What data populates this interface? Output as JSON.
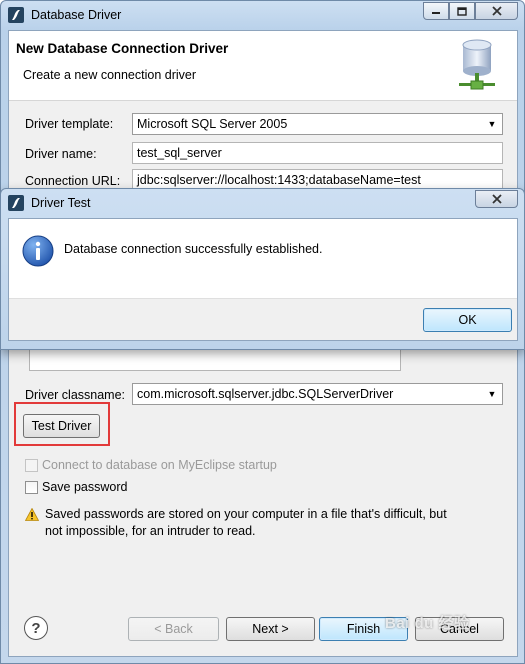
{
  "window": {
    "title": "Database Driver"
  },
  "banner": {
    "title": "New Database Connection Driver",
    "subtitle": "Create a new connection driver"
  },
  "form": {
    "driver_template_label": "Driver template:",
    "driver_template_value": "Microsoft SQL Server 2005",
    "driver_name_label": "Driver name:",
    "driver_name_value": "test_sql_server",
    "connection_url_label": "Connection URL:",
    "connection_url_value": "jdbc:sqlserver://localhost:1433;databaseName=test",
    "driver_classname_label": "Driver classname:",
    "driver_classname_value": "com.microsoft.sqlserver.jdbc.SQLServerDriver",
    "test_driver_label": "Test Driver",
    "connect_on_startup_label": "Connect to database on MyEclipse startup",
    "connect_on_startup_checked": false,
    "save_password_label": "Save password",
    "save_password_checked": false,
    "warning_line1": "Saved passwords are stored on your computer in a file that's difficult, but",
    "warning_line2": "not impossible, for an intruder to read."
  },
  "footer": {
    "help_symbol": "?",
    "back_label": "< Back",
    "next_label": "Next >",
    "finish_label": "Finish",
    "cancel_label": "Cancel"
  },
  "dialog": {
    "title": "Driver Test",
    "message": "Database connection successfully established.",
    "ok_label": "OK"
  },
  "watermark": {
    "text": "Bai du 经验"
  },
  "icons": {
    "app": "myeclipse-logo-icon",
    "banner": "database-driver-icon",
    "info": "information-icon",
    "warning": "warning-triangle-icon",
    "help": "help-icon"
  },
  "colors": {
    "highlight_box": "#e23a3a",
    "title_gradient_top": "#cddff2",
    "default_button": "#bee6fd"
  }
}
